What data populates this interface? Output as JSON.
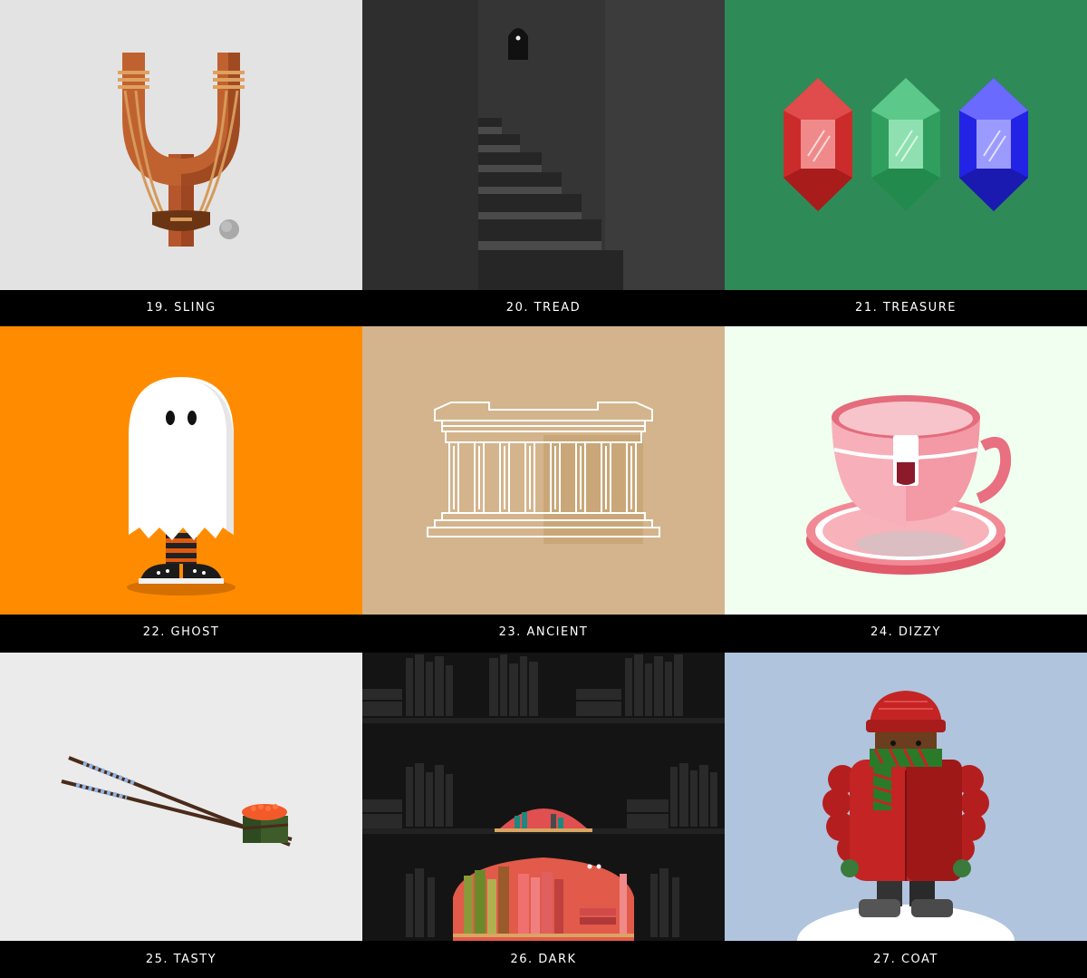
{
  "tiles": [
    {
      "label": "19. SLING",
      "bg": "#e3e3e3",
      "icon": "slingshot"
    },
    {
      "label": "20. TREAD",
      "bg": "#3c3c3c",
      "icon": "staircase"
    },
    {
      "label": "21. TREASURE",
      "bg": "#2e8b57",
      "icon": "gems"
    },
    {
      "label": "22. GHOST",
      "bg": "#ff8c00",
      "icon": "ghost"
    },
    {
      "label": "23. ANCIENT",
      "bg": "#d3b48c",
      "icon": "parthenon"
    },
    {
      "label": "24. DIZZY",
      "bg": "#f0fff0",
      "icon": "teacup"
    },
    {
      "label": "25. TASTY",
      "bg": "#ebebeb",
      "icon": "chopsticks-sushi"
    },
    {
      "label": "26. DARK",
      "bg": "#141414",
      "icon": "bookshelf"
    },
    {
      "label": "27. COAT",
      "bg": "#b0c4de",
      "icon": "puffer-coat-person"
    }
  ]
}
